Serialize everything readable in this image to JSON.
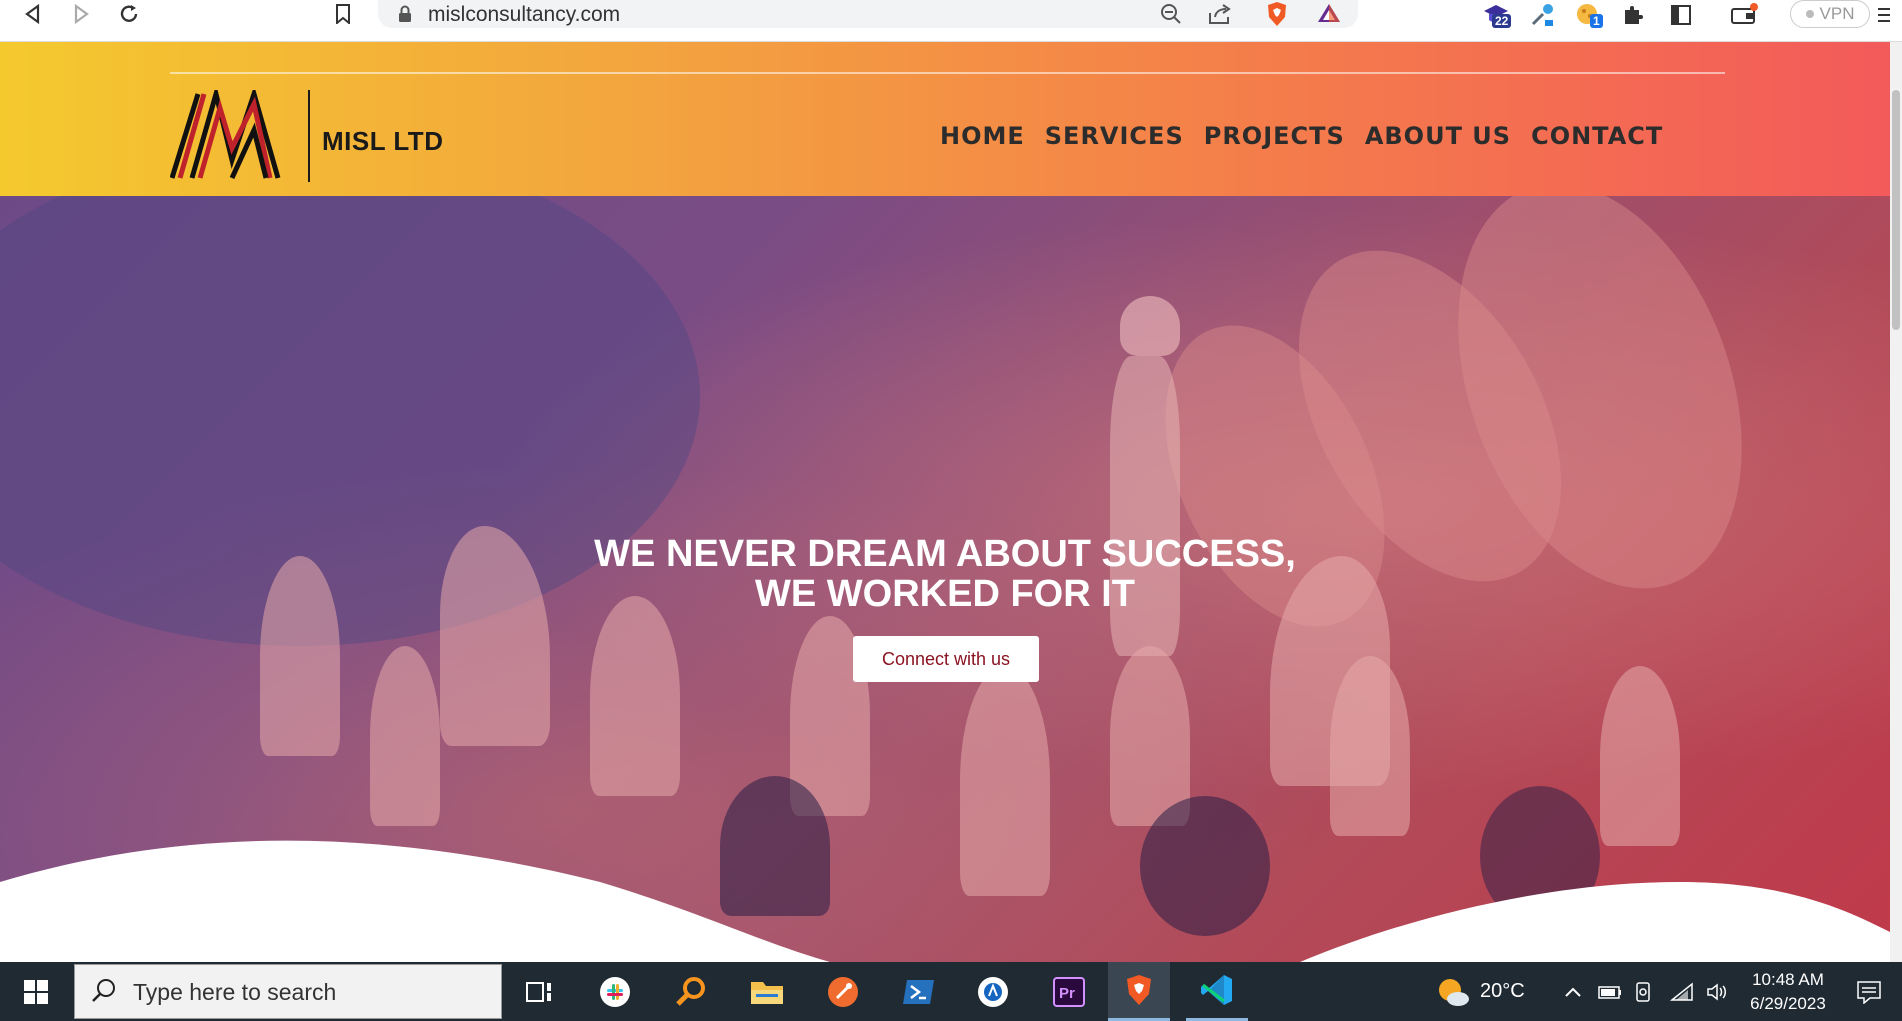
{
  "browser": {
    "url": "mislconsultancy.com",
    "badges": {
      "ext1": "22",
      "ext3": "1"
    },
    "vpn_label": "VPN"
  },
  "site": {
    "logo_text": "MISL LTD",
    "menu": [
      {
        "label": "HOME"
      },
      {
        "label": "SERVICES"
      },
      {
        "label": "PROJECTS"
      },
      {
        "label": "ABOUT US"
      },
      {
        "label": "CONTACT"
      }
    ],
    "hero": {
      "title_line1": "WE NEVER DREAM ABOUT SUCCESS,",
      "title_line2": "WE WORKED FOR IT",
      "button_label": "Connect with us"
    }
  },
  "taskbar": {
    "search_placeholder": "Type here to search",
    "weather": "20°C",
    "time": "10:48 AM",
    "date": "6/29/2023"
  },
  "colors": {
    "header_gradient": [
      "#f4c92e",
      "#f3a33f",
      "#f47f4a",
      "#f35a5a"
    ],
    "hero_overlay": [
      "#6d4a86",
      "#9c4f6e",
      "#c0394a"
    ],
    "button_text": "#8b1322",
    "taskbar": "#1f2a33"
  }
}
